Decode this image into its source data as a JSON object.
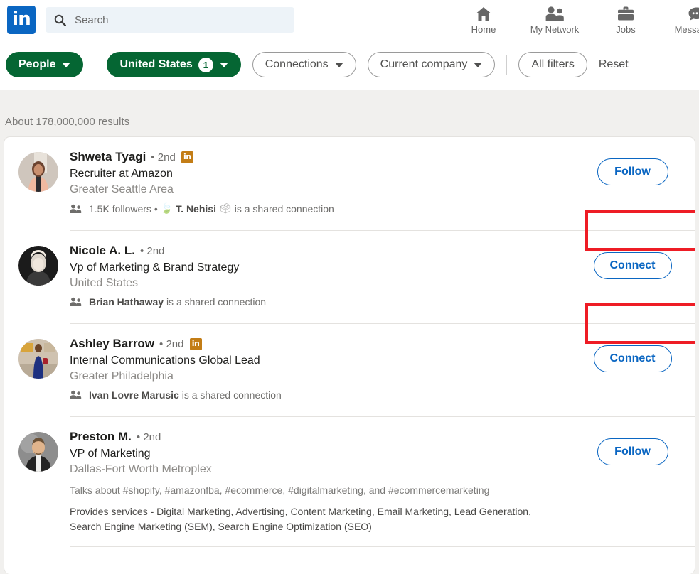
{
  "nav": {
    "logo_text": "in",
    "logo_color": "#0a66c2",
    "search_placeholder": "Search",
    "search_value": "",
    "items": [
      {
        "label": "Home",
        "icon": "home-icon"
      },
      {
        "label": "My Network",
        "icon": "people-icon"
      },
      {
        "label": "Jobs",
        "icon": "briefcase-icon"
      },
      {
        "label": "Messaging",
        "icon": "message-bubble-icon"
      }
    ]
  },
  "filters": {
    "people_label": "People",
    "location_label": "United States",
    "location_count": "1",
    "connections_label": "Connections",
    "company_label": "Current company",
    "all_filters_label": "All filters",
    "reset_label": "Reset",
    "active_color": "#056633"
  },
  "results": {
    "count_text": "About 178,000,000 results",
    "items": [
      {
        "name": "Shweta Tyagi",
        "degree": "• 2nd",
        "premium": true,
        "headline": "Recruiter at Amazon",
        "location": "Greater Seattle Area",
        "shared_prefix": "1.5K followers • ",
        "shared_name": "T. Nehisi",
        "shared_suffix": "is a shared connection",
        "action_label": "Follow",
        "highlighted": false,
        "extras": []
      },
      {
        "name": "Nicole A. L.",
        "degree": "• 2nd",
        "premium": false,
        "headline": "Vp of Marketing & Brand Strategy",
        "location": "United States",
        "shared_prefix": "",
        "shared_name": "Brian Hathaway",
        "shared_suffix": "is a shared connection",
        "action_label": "Connect",
        "highlighted": true,
        "extras": []
      },
      {
        "name": "Ashley Barrow",
        "degree": "• 2nd",
        "premium": true,
        "headline": "Internal Communications Global Lead",
        "location": "Greater Philadelphia",
        "shared_prefix": "",
        "shared_name": "Ivan Lovre Marusic",
        "shared_suffix": "is a shared connection",
        "action_label": "Connect",
        "highlighted": true,
        "extras": []
      },
      {
        "name": "Preston M.",
        "degree": "• 2nd",
        "premium": false,
        "headline": "VP of Marketing",
        "location": "Dallas-Fort Worth Metroplex",
        "shared_prefix": "",
        "shared_name": "",
        "shared_suffix": "",
        "action_label": "Follow",
        "highlighted": false,
        "extras": [
          "Talks about #shopify, #amazonfba, #ecommerce, #digitalmarketing, and #ecommercemarketing",
          "Provides services - Digital Marketing, Advertising, Content Marketing, Email Marketing, Lead Generation, Search Engine Marketing (SEM), Search Engine Optimization (SEO)"
        ]
      }
    ]
  },
  "colors": {
    "brand_blue": "#0a66c2",
    "highlight_red": "#ee1c25",
    "premium_gold": "#c37d16",
    "page_bg": "#f1f0ee"
  }
}
